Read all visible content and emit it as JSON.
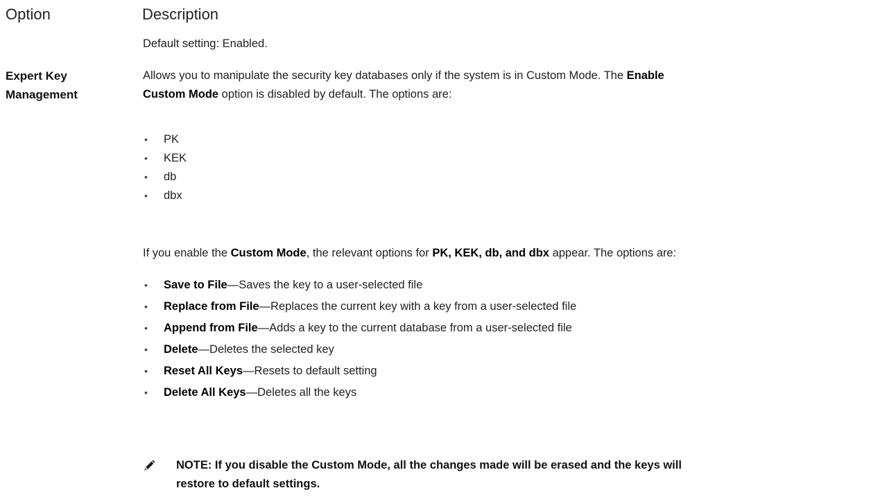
{
  "header": {
    "option": "Option",
    "description": "Description"
  },
  "default_setting": "Default setting: Enabled.",
  "option_name": {
    "line1": "Expert Key",
    "line2": "Management"
  },
  "intro": {
    "t1": "Allows you to manipulate the security key databases only if the system is in Custom Mode. The ",
    "b1": "Enable",
    "b2": "Custom Mode",
    "t2": " option is disabled by default. The options are:"
  },
  "db_options": [
    "PK",
    "KEK",
    "db",
    "dbx"
  ],
  "enable_para": {
    "t1": "If you enable the ",
    "b1": "Custom Mode",
    "t2": ", the relevant options for ",
    "b2": "PK, KEK, db, and dbx",
    "t3": " appear. The options are:"
  },
  "actions": [
    {
      "name": "Save to File",
      "desc": "—Saves the key to a user-selected file"
    },
    {
      "name": "Replace from File",
      "desc": "—Replaces the current key with a key from a user-selected file"
    },
    {
      "name": "Append from File",
      "desc": "—Adds a key to the current database from a user-selected file"
    },
    {
      "name": "Delete",
      "desc": "—Deletes the selected key"
    },
    {
      "name": "Reset All Keys",
      "desc": "—Resets to default setting"
    },
    {
      "name": "Delete All Keys",
      "desc": "—Deletes all the keys"
    }
  ],
  "note": {
    "line1": "NOTE: If you disable the Custom Mode, all the changes made will be erased and the keys will",
    "line2": "restore to default settings.",
    "icon": "pencil-note-icon"
  }
}
